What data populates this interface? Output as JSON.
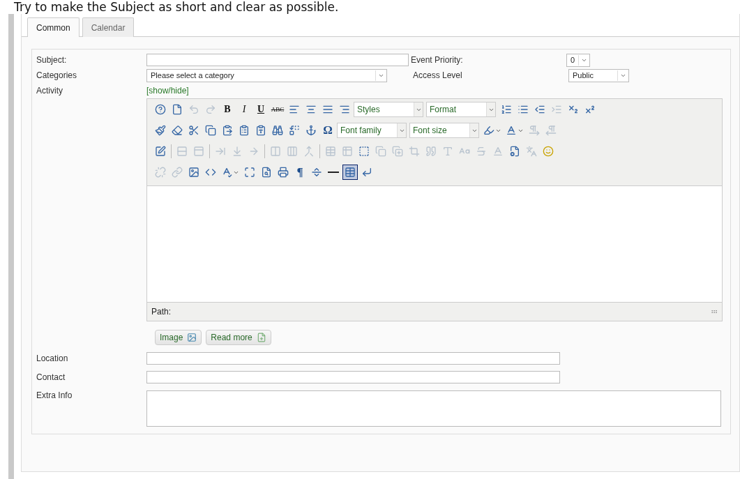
{
  "instruction": "Try to make the Subject as short and clear as possible.",
  "tabs": [
    {
      "label": "Common",
      "selected": true
    },
    {
      "label": "Calendar",
      "selected": false
    }
  ],
  "form": {
    "subject": {
      "label": "Subject:"
    },
    "event_priority": {
      "label": "Event Priority:",
      "value": "0"
    },
    "categories": {
      "label": "Categories",
      "value": "Please select a category"
    },
    "access_level": {
      "label": "Access Level",
      "value": "Public"
    },
    "activity": {
      "label": "Activity",
      "toggle": "[show/hide]"
    },
    "location": {
      "label": "Location"
    },
    "contact": {
      "label": "Contact"
    },
    "extra_info": {
      "label": "Extra Info"
    }
  },
  "editor": {
    "toolbar": [
      {
        "items": [
          {
            "kind": "icon",
            "disabled": false
          },
          {
            "kind": "icon",
            "disabled": false
          },
          {
            "kind": "icon",
            "disabled": true
          },
          {
            "kind": "icon",
            "disabled": true
          },
          {
            "kind": "glyph",
            "text": "B"
          },
          {
            "kind": "glyph",
            "text": "I"
          },
          {
            "kind": "glyph",
            "text": "U"
          },
          {
            "kind": "glyph",
            "text": "ABC"
          },
          {
            "kind": "icon",
            "disabled": false
          },
          {
            "kind": "icon",
            "disabled": false
          },
          {
            "kind": "icon",
            "disabled": false
          },
          {
            "kind": "icon",
            "disabled": false
          },
          {
            "kind": "dropdown",
            "label": "Styles"
          },
          {
            "kind": "dropdown",
            "label": "Format"
          },
          {
            "kind": "icon",
            "disabled": false
          },
          {
            "kind": "icon",
            "disabled": false
          },
          {
            "kind": "icon",
            "disabled": false
          },
          {
            "kind": "icon",
            "disabled": true
          },
          {
            "kind": "icon",
            "disabled": false
          },
          {
            "kind": "icon",
            "disabled": false
          }
        ]
      },
      {
        "items": [
          {
            "kind": "icon",
            "disabled": false
          },
          {
            "kind": "icon",
            "disabled": false
          },
          {
            "kind": "icon",
            "disabled": false
          },
          {
            "kind": "icon",
            "disabled": false
          },
          {
            "kind": "icon",
            "disabled": false
          },
          {
            "kind": "icon",
            "disabled": false
          },
          {
            "kind": "icon",
            "disabled": false
          },
          {
            "kind": "icon",
            "disabled": false
          },
          {
            "kind": "icon",
            "disabled": false
          },
          {
            "kind": "icon",
            "disabled": false
          },
          {
            "kind": "glyph",
            "text": "Ω"
          },
          {
            "kind": "dropdown",
            "label": "Font family"
          },
          {
            "kind": "dropdown",
            "label": "Font size"
          },
          {
            "kind": "icon",
            "disabled": false,
            "split": true
          },
          {
            "kind": "icon",
            "disabled": false,
            "split": true
          },
          {
            "kind": "icon",
            "disabled": true
          },
          {
            "kind": "icon",
            "disabled": true
          }
        ]
      },
      {
        "items": [
          {
            "kind": "icon",
            "disabled": false
          },
          {
            "kind": "separator"
          },
          {
            "kind": "icon",
            "disabled": true
          },
          {
            "kind": "icon",
            "disabled": true
          },
          {
            "kind": "separator"
          },
          {
            "kind": "icon",
            "disabled": true
          },
          {
            "kind": "icon",
            "disabled": true
          },
          {
            "kind": "icon",
            "disabled": true
          },
          {
            "kind": "separator"
          },
          {
            "kind": "icon",
            "disabled": true
          },
          {
            "kind": "icon",
            "disabled": true
          },
          {
            "kind": "icon",
            "disabled": true
          },
          {
            "kind": "separator"
          },
          {
            "kind": "icon",
            "disabled": true
          },
          {
            "kind": "icon",
            "disabled": true
          },
          {
            "kind": "icon",
            "disabled": false
          },
          {
            "kind": "icon",
            "disabled": true
          },
          {
            "kind": "icon",
            "disabled": true
          },
          {
            "kind": "icon",
            "disabled": true
          },
          {
            "kind": "icon",
            "disabled": true
          },
          {
            "kind": "icon",
            "disabled": true
          },
          {
            "kind": "icon",
            "disabled": true
          },
          {
            "kind": "icon",
            "disabled": true
          },
          {
            "kind": "icon",
            "disabled": true
          },
          {
            "kind": "icon",
            "disabled": false
          },
          {
            "kind": "icon",
            "disabled": true
          },
          {
            "kind": "icon",
            "disabled": false
          }
        ]
      },
      {
        "items": [
          {
            "kind": "icon",
            "disabled": true
          },
          {
            "kind": "icon",
            "disabled": true
          },
          {
            "kind": "icon",
            "disabled": false
          },
          {
            "kind": "icon",
            "disabled": false
          },
          {
            "kind": "icon",
            "disabled": false,
            "split": true
          },
          {
            "kind": "icon",
            "disabled": false
          },
          {
            "kind": "icon",
            "disabled": false
          },
          {
            "kind": "icon",
            "disabled": false
          },
          {
            "kind": "glyph",
            "text": "¶"
          },
          {
            "kind": "icon",
            "disabled": false
          },
          {
            "kind": "icon",
            "disabled": false
          },
          {
            "kind": "icon",
            "disabled": false,
            "active": true
          },
          {
            "kind": "icon",
            "disabled": false
          }
        ]
      }
    ],
    "path_label": "Path:"
  },
  "buttons": [
    {
      "label": "Image"
    },
    {
      "label": "Read more"
    }
  ]
}
